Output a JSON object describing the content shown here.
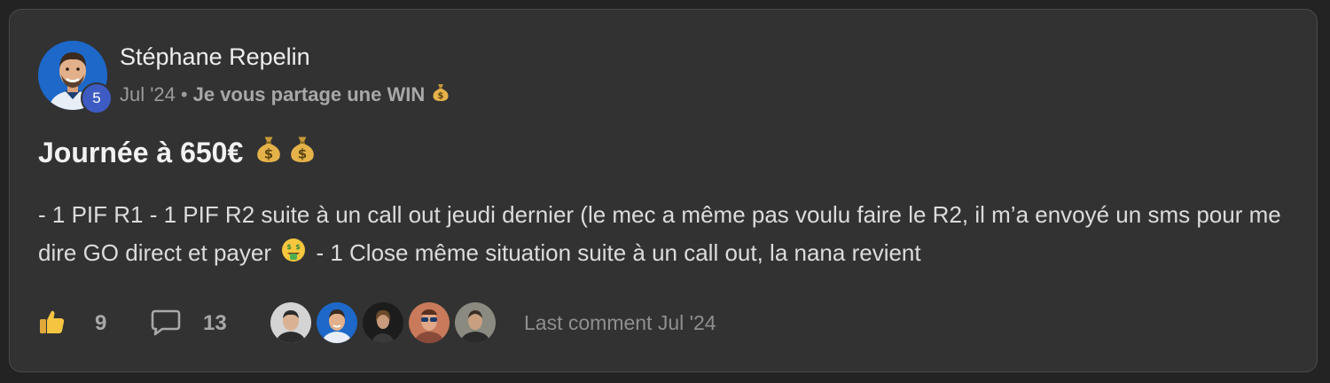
{
  "post": {
    "author": "Stéphane Repelin",
    "level": "5",
    "date": "Jul '24",
    "separator": "•",
    "category": "Je vous partage une WIN",
    "title": "Journée à 650€",
    "body_part1": "- 1 PIF R1 - 1 PIF R2 suite à un call out jeudi dernier (le mec a même pas voulu faire le R2, il m’a envoyé un sms pour me dire GO direct et payer",
    "body_part2": "- 1 Close même situation suite à un call out, la nana revient"
  },
  "footer": {
    "likes": "9",
    "comments": "13",
    "last_comment": "Last comment Jul '24"
  },
  "icons": {
    "money_bag": "money-bag-emoji",
    "money_mouth": "money-mouth-face-emoji",
    "like": "thumbs-up-icon",
    "comment": "speech-bubble-icon"
  },
  "colors": {
    "card_bg": "#323232",
    "page_bg": "#232323",
    "level_badge": "#3d5bc2",
    "thumb_yellow": "#f5c542"
  }
}
